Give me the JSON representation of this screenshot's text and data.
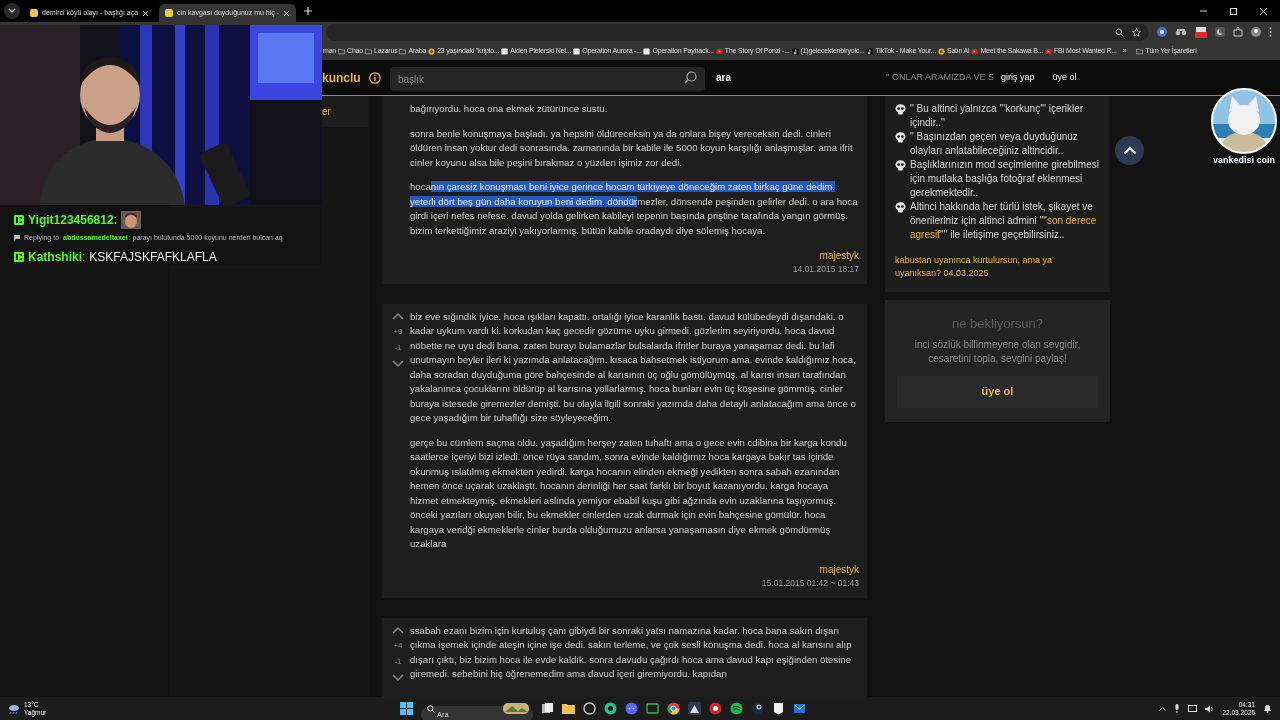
{
  "browser": {
    "tabs": [
      {
        "title": "demirci köyü olayı - başlığı aça",
        "selected": false
      },
      {
        "title": "cin kavgası duyduğunuz mu hiç -",
        "selected": true
      }
    ],
    "bookmarks": [
      {
        "label": "man",
        "kind": "cut"
      },
      {
        "label": "Chao",
        "kind": "folder"
      },
      {
        "label": "Lazarus",
        "kind": "folder"
      },
      {
        "label": "Araba",
        "kind": "folder"
      },
      {
        "label": "23 yaşındaki \"kripto...",
        "kind": "coin"
      },
      {
        "label": "Aiden Pleterski Net...",
        "kind": "site"
      },
      {
        "label": "Operation Aurora -...",
        "kind": "site"
      },
      {
        "label": "Operation Payback...",
        "kind": "site"
      },
      {
        "label": "The Story Of Ponzi -...",
        "kind": "video"
      },
      {
        "label": "(1)gelecektenbiryolc...",
        "kind": "note"
      },
      {
        "label": "TikTok - Make Your...",
        "kind": "note"
      },
      {
        "label": "Satın Al",
        "kind": "coin"
      },
      {
        "label": "Meet the Sakawa B...",
        "kind": "video"
      },
      {
        "label": "FBI Most Wanted R...",
        "kind": "video"
      }
    ],
    "more": "»",
    "all_bookmarks": "Tüm Yer İşaretleri"
  },
  "chat": [
    {
      "kind": "message",
      "user": "Yigit123456812",
      "colon": ":",
      "emote": true
    },
    {
      "kind": "reply",
      "prefix": "Replying to",
      "user": "abdussamedeltaxei",
      "text": ": parayı bulutunda 5000 koyunu nerden bulcan aq"
    },
    {
      "kind": "message",
      "user": "Kathshiki",
      "colon": ":",
      "text": "KSKFAJSKFAFKLAFLA",
      "emote": false
    }
  ],
  "header": {
    "logo": "kunclu",
    "search_placeholder": "başlık",
    "search_button": "ara",
    "motto": "'' ONLAR ARAMIZDA VE S",
    "login": "giriş yap",
    "signup": "üye ol"
  },
  "sidebar": {
    "items": [
      "er"
    ]
  },
  "entries": [
    {
      "paragraphs": [
        [
          {
            "text": "bağırıyordu. hoca ona ekmek zütürünce sustu.",
            "selected": false
          }
        ],
        [
          {
            "text": "sonra benle konuşmaya başladı. ya hepsini öldüreceksin ya da onlara bişey vereceksin dedi. cinleri öldüren insan yoktur dedi sonrasında. zamanında bir kabile ile 5000 koyun karşılığı anlaşmışlar. ama ifrit cinler koyunu alsa bile peşini bırakmaz o yüzden işimiz zor dedi.",
            "selected": false
          }
        ],
        [
          {
            "text": "hoca",
            "selected": false
          },
          {
            "text": "nın çaresiz konuşması beni iyice gerince hocam türkiyeye döneceğim zaten birkaç güne dedim. yeterli dört beş gün daha koruyun beni dedim. döndür",
            "selected": true
          },
          {
            "text": "mezler, dönsende peşinden gelirler dedi. o ara hoca girdi içeri nefes nefese. davud yolda gelirken kabileyi tepenin başında priştine tarafında yangın görmüş. bizim terkettiğimiz araziyi yakıyorlarmış. bütün kabile oradaydı diye sölemiş hocaya.",
            "selected": false
          }
        ]
      ],
      "author": "majestyk",
      "date": "14.01.2015 18:17"
    },
    {
      "up": "+9",
      "down": "-1",
      "paragraphs": [
        [
          {
            "text": "biz eve sığındık iyice. hoca ışıkları kapattı. ortalığı iyice karanlık bastı. davud külübedeydi dışarıdaki. o kadar uykum vardı ki. korkudan kaç gecedir gözüme uyku girmedi. gözlerim seyiriyordu. hoca davud nöbette ne uyu dedi bana. zaten burayı bulamazlar bulsalarda ifritler buraya yanaşamaz dedi. bu lafi unutmayın beyler ileri ki yazımda anlatacağım. kısaca bahsetmek istiyorum ama. evinde kaldığımız hoca, daha soradan duyduğuma göre bahçesinde al karısının üç oğlu gömülüymüş. al karısı insan tarafından yakalanınca çocuklarını öldürüp al karısına yollarlarmış. hoca bunları evin üç köşesine gömmüş. cinler buraya istesede giremezler demişti. bu olayla ilgili sonraki yazımda daha detaylı anlatacağım ama önce o gece yaşadığım bir tuhaflığı size söyleyeceğim.",
            "selected": false
          }
        ],
        [
          {
            "text": "gerçe bu cümlem saçma oldu. yaşadığım herşey zaten tuhaftı ama o gece evin cdibina bir karga kondu saatlerce içeriyi bizi izledi. önce rüya sandım, sonra evinde kaldığımız hoca kargaya bakır tas içinde okunmuş ıslatılmış ekmekten yedirdi. karga hocanın elinden ekmeği yedikten sonra sabah ezanından hemen önce uçarak uzaklaştı. hocanın derinliği her saat farklı bir boyut kazanıyordu. karga hocaya hizmet etmekteymiş. ekmekleri aslında yemiyor ebabil kuşu gibi ağzında evin uzaklarına taşıyormuş. önceki yazıları okuyan bilir, bu ekmekler cinlerden uzak durmak için evin bahçesine gömülür. hoca kargaya veridği ekmeklerle cinler burda olduğumuzu anlarsa yanaşamasın diye ekmek gömdürmüş uzaklara",
            "selected": false
          }
        ]
      ],
      "author": "majestyk",
      "date": "15.01.2015 01:42 ~ 01:43"
    },
    {
      "up": "+4",
      "down": "-1",
      "paragraphs": [
        [
          {
            "text": "ssabah ezanı bizim için kurtuluş çanı gibiydi bir sonraki yatsı namazına kadar. hoca bana sakın dışarı çıkma işemek içinde ateşin içine işe dedi. sakın terleme, ve çok sesli konuşma dedi. hoca al karısını alıp dışarı çıktı, biz bizim hoca ile evde kaldık. sonra davudu çağırdı hoca ama davud kapı eşiğinden ötesine giremedi. sebebini hiç öğrenemedim ama davud içeri giremiyordu. kapıdan",
            "selected": false
          }
        ]
      ]
    }
  ],
  "rules": [
    [
      {
        "text": "'' Bu altinci yalnızca '''korkunç''' içerikler içindir..''",
        "accent": false
      }
    ],
    [
      {
        "text": "'' Başınızdan geçen veya duyduğunuz olayları anlatabileceğiniz altincidir..",
        "accent": false
      }
    ],
    [
      {
        "text": "Başlıklarınızın mod seçimlerine girebilmesi için mutlaka başlığa fotoğraf eklenmesi gerekmektedir..",
        "accent": false
      }
    ],
    [
      {
        "text": "Altinci hakkında her türlü istek, şikayet ve önerileriniz için altinci admini ''\"",
        "accent": false
      },
      {
        "text": "son derece agresif",
        "accent": true
      },
      {
        "text": "\"'' ile iletişime geçebilirsiniz..",
        "accent": false
      }
    ]
  ],
  "rules_footer": "kabustan uyanınca kurtulursun, ama ya uyanıksan? 04.03.2025",
  "join_card": {
    "title": "ne bekliyorsun?",
    "text": "inci sözlük billinmeyene olan sevgidir, cesaretini topla, sevgini paylaş!",
    "button": "üye ol"
  },
  "avatar_overlay": {
    "caption": "vankedisi coin"
  },
  "taskbar": {
    "temperature": "13°C",
    "weather": "Yağmur",
    "search_placeholder": "Ara",
    "time": "04:31",
    "date": "22.03.2026"
  }
}
